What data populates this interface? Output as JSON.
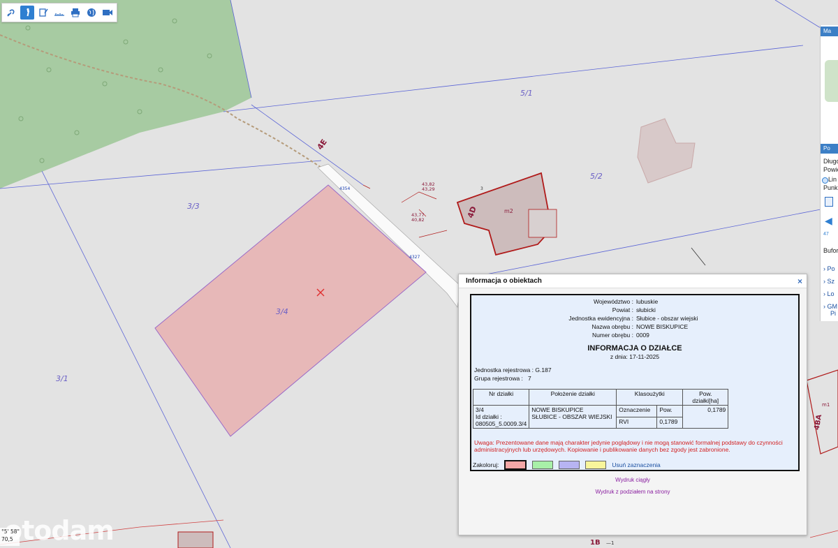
{
  "map": {
    "parcel_labels": [
      "5/1",
      "5/2",
      "3/3",
      "3/4",
      "3/1"
    ],
    "land_use_labels": [
      "4E",
      "4D",
      "4BA",
      "1B"
    ],
    "building_label": "m2",
    "annotations": [
      "43,82",
      "43,29",
      "43,77",
      "40,82",
      "4354",
      "4327",
      "m1",
      "3",
      "—1"
    ],
    "highlight_color": "#e7b8b8",
    "forest_color": "#a7cba2"
  },
  "toolbar": {
    "tools": [
      "link-icon",
      "info-icon",
      "edit-icon",
      "measure-icon",
      "print-icon",
      "globe-icon",
      "camera-icon"
    ]
  },
  "right_panel": {
    "heading1": "Ma",
    "heading2": "Po",
    "lines": [
      "Długo",
      "Powie",
      "Lin",
      "Punk"
    ],
    "bufor": "Bufor[",
    "links": [
      "Po",
      "Sz",
      "Lo",
      "GM",
      "Pi"
    ],
    "coord_small": "47"
  },
  "popup": {
    "title": "Informacja o obiektach",
    "close": "×",
    "header_rows": [
      {
        "label": "Województwo :",
        "value": "lubuskie"
      },
      {
        "label": "Powiat :",
        "value": "słubicki"
      },
      {
        "label": "Jednostka ewidencyjna :",
        "value": "Słubice - obszar wiejski"
      },
      {
        "label": "Nazwa obrębu :",
        "value": "NOWE BISKUPICE"
      },
      {
        "label": "Numer obrębu :",
        "value": "0009"
      }
    ],
    "card_title": "INFORMACJA O DZIAŁCE",
    "date_label": "z dnia: 17-11-2025",
    "registry_unit_label": "Jednostka rejestrowa :",
    "registry_unit_value": "G.187",
    "registry_group_label": "Grupa rejestrowa :",
    "registry_group_value": "7",
    "table_headers": [
      "Nr działki",
      "Położenie działki",
      "Klasoużytki",
      "Pow. działki[ha]"
    ],
    "sub_headers": [
      "Oznaczenie",
      "Pow."
    ],
    "row": {
      "nr": "3/4",
      "id_label": "Id działki :",
      "id_value": "080505_5.0009.3/4",
      "location_line1": "NOWE BISKUPICE",
      "location_line2": "SŁUBICE - OBSZAR WIEJSKI",
      "class": "RVI",
      "class_area": "0,1789",
      "area": "0,1789"
    },
    "warning": "Uwaga: Prezentowane dane mają charakter jedynie poglądowy i nie mogą stanowić formalnej podstawy do czynności administracyjnych lub urzędowych. Kopiowanie i publikowanie danych bez zgody jest zabronione.",
    "color_label": "Zakoloruj:",
    "swatches": [
      "#f2a7a7",
      "#a8f0a8",
      "#b7b4f2",
      "#f8f59b"
    ],
    "clear_label": "Usuń zaznaczenia",
    "print_continuous": "Wydruk ciągły",
    "print_pages": "Wydruk z podziałem na strony"
  },
  "overlay": {
    "watermark": "otodam",
    "coord_line1": "°5' 58\"",
    "coord_line2": "70,5"
  }
}
